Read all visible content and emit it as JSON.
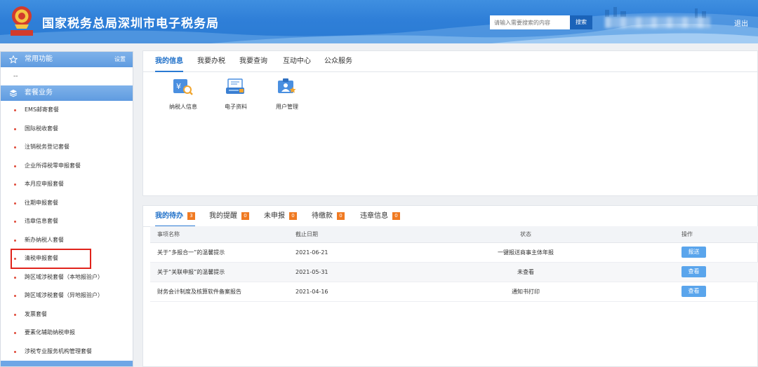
{
  "header": {
    "site_title": "国家税务总局深圳市电子税务局",
    "emblem_text": "中国税务",
    "search_placeholder": "请输入需要搜索的内容",
    "search_button": "搜索",
    "logout": "退出"
  },
  "sidebar": {
    "common": {
      "label": "常用功能",
      "setting": "设置",
      "placeholder": "--"
    },
    "package": {
      "label": "套餐业务"
    },
    "items": [
      "EMS邮寄套餐",
      "国际税收套餐",
      "注销税务登记套餐",
      "企业所得税零申报套餐",
      "本月应申报套餐",
      "往期申报套餐",
      "违章信息套餐",
      "新办纳税人套餐",
      "清税申报套餐",
      "跨区域涉税套餐（本地报验户）",
      "跨区域涉税套餐（异地报验户）",
      "发票套餐",
      "要素化辅助纳税申报",
      "涉税专业服务机构管理套餐"
    ],
    "highlighted_index": 8
  },
  "top_panel": {
    "tabs": [
      "我的信息",
      "我要办税",
      "我要查询",
      "互动中心",
      "公众服务"
    ],
    "active_tab": 0,
    "tiles": [
      {
        "label": "纳税人信息",
        "icon": "taxpayer-info-icon"
      },
      {
        "label": "电子资料",
        "icon": "electronic-data-icon"
      },
      {
        "label": "用户管理",
        "icon": "user-management-icon"
      }
    ]
  },
  "bottom_panel": {
    "tabs": [
      {
        "label": "我的待办",
        "count": "3"
      },
      {
        "label": "我的提醒",
        "count": "0"
      },
      {
        "label": "未申报",
        "count": "0"
      },
      {
        "label": "待缴款",
        "count": "0"
      },
      {
        "label": "违章信息",
        "count": "0"
      }
    ],
    "active_tab": 0,
    "columns": [
      "事项名称",
      "截止日期",
      "状态",
      "操作"
    ],
    "rows": [
      {
        "name": "关于“多报合一”的温馨提示",
        "date": "2021-06-21",
        "status": "一键报送商事主体年报",
        "action": "报送"
      },
      {
        "name": "关于“关联申报”的温馨提示",
        "date": "2021-05-31",
        "status": "未查看",
        "action": "查看"
      },
      {
        "name": "财务会计制度及核算软件备案报告",
        "date": "2021-04-16",
        "status": "通知书打印",
        "action": "查看"
      }
    ]
  },
  "colors": {
    "header_blue": "#2f7fd8",
    "accent": "#1e6fc8",
    "badge": "#f07a22",
    "highlight": "#e0231b"
  }
}
